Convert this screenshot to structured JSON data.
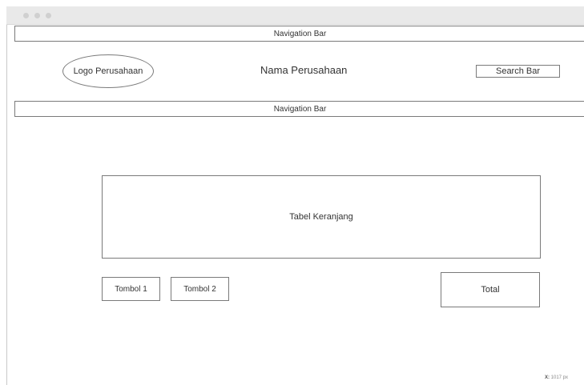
{
  "top_nav": {
    "label": "Navigation Bar"
  },
  "header": {
    "logo": "Logo Perusahaan",
    "company_name": "Nama Perusahaan",
    "search": "Search Bar"
  },
  "secondary_nav": {
    "label": "Navigation Bar"
  },
  "main": {
    "cart_table": "Tabel Keranjang",
    "button_1": "Tombol 1",
    "button_2": "Tombol 2",
    "total": "Total"
  },
  "status": {
    "coord_label": "X:",
    "coord_value": "1017 px"
  }
}
